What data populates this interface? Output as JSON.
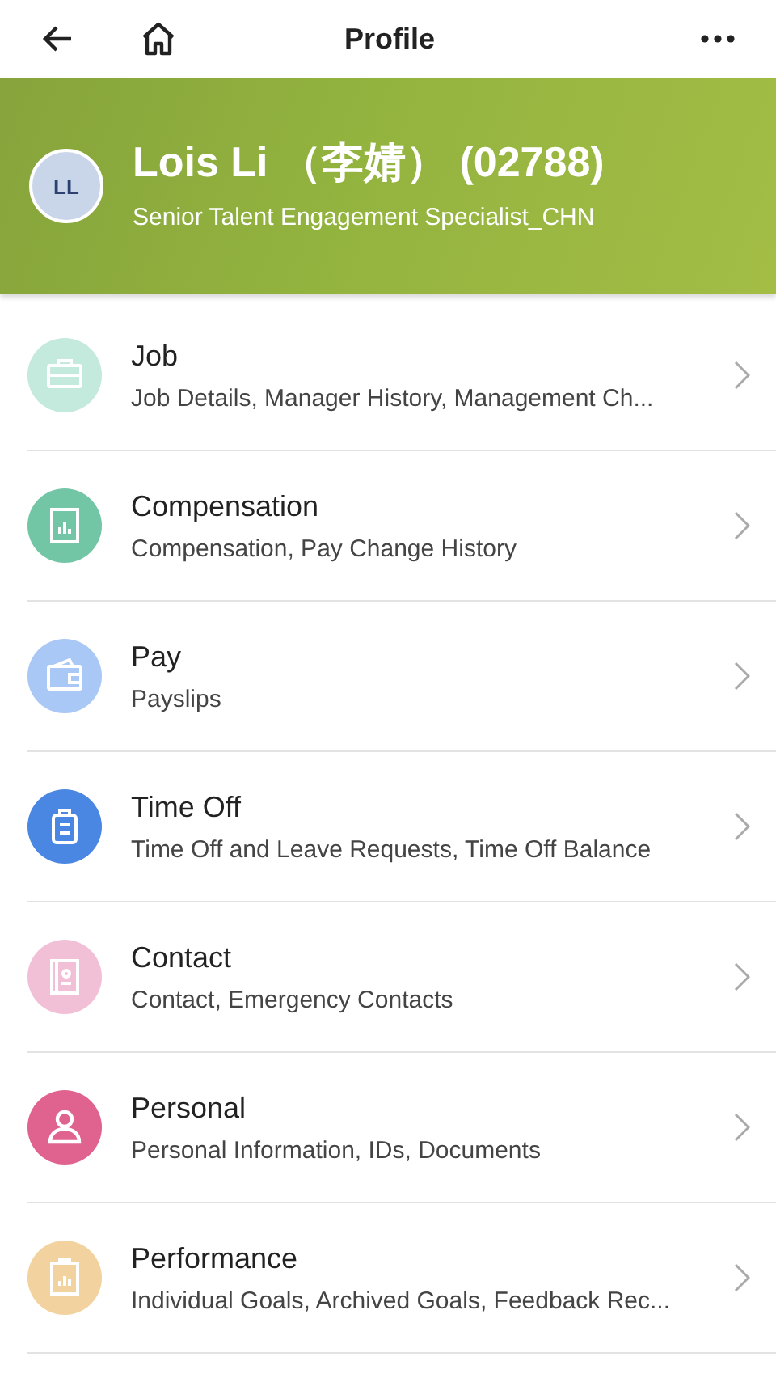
{
  "header": {
    "title": "Profile"
  },
  "profile": {
    "initials": "LL",
    "name": "Lois Li （李婧） (02788)",
    "position": "Senior Talent Engagement Specialist_CHN"
  },
  "items": [
    {
      "kind": "briefcase",
      "color": "#c3eadc",
      "title": "Job",
      "subtitle": "Job Details, Manager History, Management Ch..."
    },
    {
      "kind": "chart",
      "color": "#72c6a6",
      "title": "Compensation",
      "subtitle": "Compensation, Pay Change History"
    },
    {
      "kind": "wallet",
      "color": "#a9c8f6",
      "title": "Pay",
      "subtitle": "Payslips"
    },
    {
      "kind": "luggage",
      "color": "#4a87e2",
      "title": "Time Off",
      "subtitle": "Time Off and Leave Requests, Time Off Balance"
    },
    {
      "kind": "contact",
      "color": "#f2c0d6",
      "title": "Contact",
      "subtitle": "Contact, Emergency Contacts"
    },
    {
      "kind": "person",
      "color": "#e0628f",
      "title": "Personal",
      "subtitle": "Personal Information, IDs, Documents"
    },
    {
      "kind": "clipboard",
      "color": "#f2d29f",
      "title": "Performance",
      "subtitle": "Individual Goals, Archived Goals, Feedback Rec..."
    }
  ]
}
